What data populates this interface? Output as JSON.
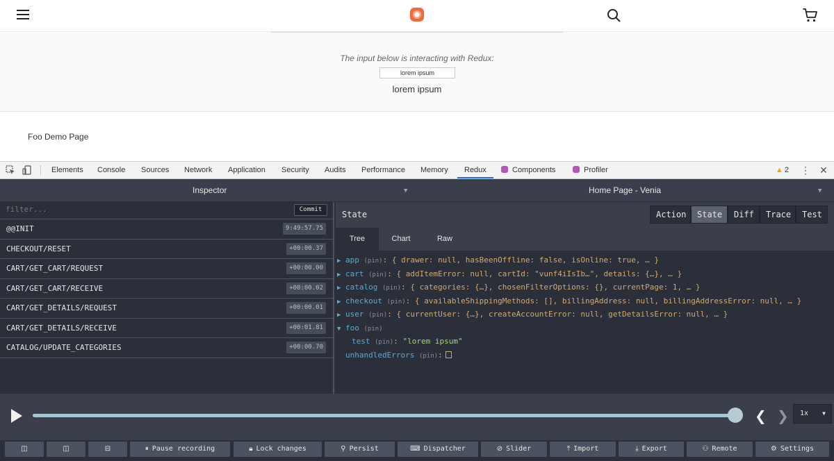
{
  "site": {
    "demo_caption": "The input below is interacting with Redux:",
    "input_value": "lorem ipsum",
    "output_text": "lorem ipsum",
    "page_title": "Foo Demo Page"
  },
  "devtools": {
    "tabs": [
      "Elements",
      "Console",
      "Sources",
      "Network",
      "Application",
      "Security",
      "Audits",
      "Performance",
      "Memory",
      "Redux",
      "Components",
      "Profiler"
    ],
    "active_tab": "Redux",
    "warning_count": "2"
  },
  "redux": {
    "inspector_label": "Inspector",
    "instance_label": "Home Page - Venia",
    "filter_placeholder": "filter...",
    "commit_label": "Commit",
    "actions": [
      {
        "name": "@@INIT",
        "time": "9:49:57.75"
      },
      {
        "name": "CHECKOUT/RESET",
        "time": "+00:00.37"
      },
      {
        "name": "CART/GET_CART/REQUEST",
        "time": "+00:00.00"
      },
      {
        "name": "CART/GET_CART/RECEIVE",
        "time": "+00:00.02"
      },
      {
        "name": "CART/GET_DETAILS/REQUEST",
        "time": "+00:00.01"
      },
      {
        "name": "CART/GET_DETAILS/RECEIVE",
        "time": "+00:01.81"
      },
      {
        "name": "CATALOG/UPDATE_CATEGORIES",
        "time": "+00:00.70"
      }
    ],
    "state_title": "State",
    "view_modes": [
      "Action",
      "State",
      "Diff",
      "Trace",
      "Test"
    ],
    "active_mode": "State",
    "subtabs": [
      "Tree",
      "Chart",
      "Raw"
    ],
    "active_subtab": "Tree",
    "pin_label": "(pin)",
    "tree": [
      {
        "arrow": "▶",
        "key": "app",
        "value": ": { drawer: null, hasBeenOffline: false, isOnline: true, … }"
      },
      {
        "arrow": "▶",
        "key": "cart",
        "value": ": { addItemError: null, cartId: \"vunf4iIsIb…\", details: {…}, … }"
      },
      {
        "arrow": "▶",
        "key": "catalog",
        "value": ": { categories: {…}, chosenFilterOptions: {}, currentPage: 1, … }"
      },
      {
        "arrow": "▶",
        "key": "checkout",
        "value": ": { availableShippingMethods: [], billingAddress: null, billingAddressError: null, … }"
      },
      {
        "arrow": "▶",
        "key": "user",
        "value": ": { currentUser: {…}, createAccountError: null, getDetailsError: null, … }"
      },
      {
        "arrow": "▼",
        "key": "foo",
        "value": ""
      },
      {
        "arrow": "",
        "key": "test",
        "value": ": ",
        "string": "\"lorem ipsum\""
      },
      {
        "arrow": "",
        "key": "unhandledErrors",
        "value": ":"
      }
    ],
    "speed": "1x",
    "bottom_buttons": [
      "Pause recording",
      "Lock changes",
      "Persist",
      "Dispatcher",
      "Slider",
      "Import",
      "Export",
      "Remote",
      "Settings"
    ]
  }
}
